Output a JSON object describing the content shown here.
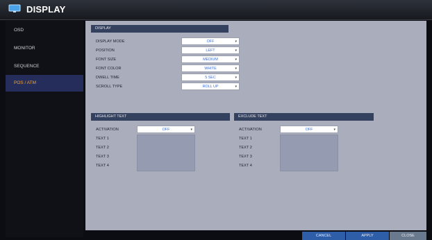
{
  "window": {
    "title": "DISPLAY"
  },
  "sidebar": {
    "items": [
      {
        "label": "OSD"
      },
      {
        "label": "MONITOR"
      },
      {
        "label": "SEQUENCE"
      },
      {
        "label": "POS / ATM"
      }
    ],
    "active_index": 3
  },
  "display_section": {
    "header": "DISPLAY",
    "rows": [
      {
        "label": "DISPLAY MODE",
        "value": "OFF"
      },
      {
        "label": "POSITION",
        "value": "LEFT"
      },
      {
        "label": "FONT SIZE",
        "value": "MEDIUM"
      },
      {
        "label": "FONT COLOR",
        "value": "WHITE"
      },
      {
        "label": "DWELL TIME",
        "value": "5 SEC"
      },
      {
        "label": "SCROLL TYPE",
        "value": "ROLL UP"
      }
    ]
  },
  "highlight_section": {
    "header": "HIGHLIGHT TEXT",
    "activation_label": "ACTIVATION",
    "activation_value": "OFF",
    "texts": [
      "TEXT 1",
      "TEXT 2",
      "TEXT 3",
      "TEXT 4"
    ]
  },
  "exclude_section": {
    "header": "EXCLUDE TEXT",
    "activation_label": "ACTIVATION",
    "activation_value": "OFF",
    "texts": [
      "TEXT 1",
      "TEXT 2",
      "TEXT 3",
      "TEXT 4"
    ]
  },
  "buttons": {
    "cancel": "CANCEL",
    "apply": "APPLY",
    "close": "CLOSE"
  },
  "colors": {
    "accent_active": "#f0a640",
    "content_bg": "#a9adbc",
    "section_header": "#34415e",
    "button": "#2f5ea9"
  }
}
